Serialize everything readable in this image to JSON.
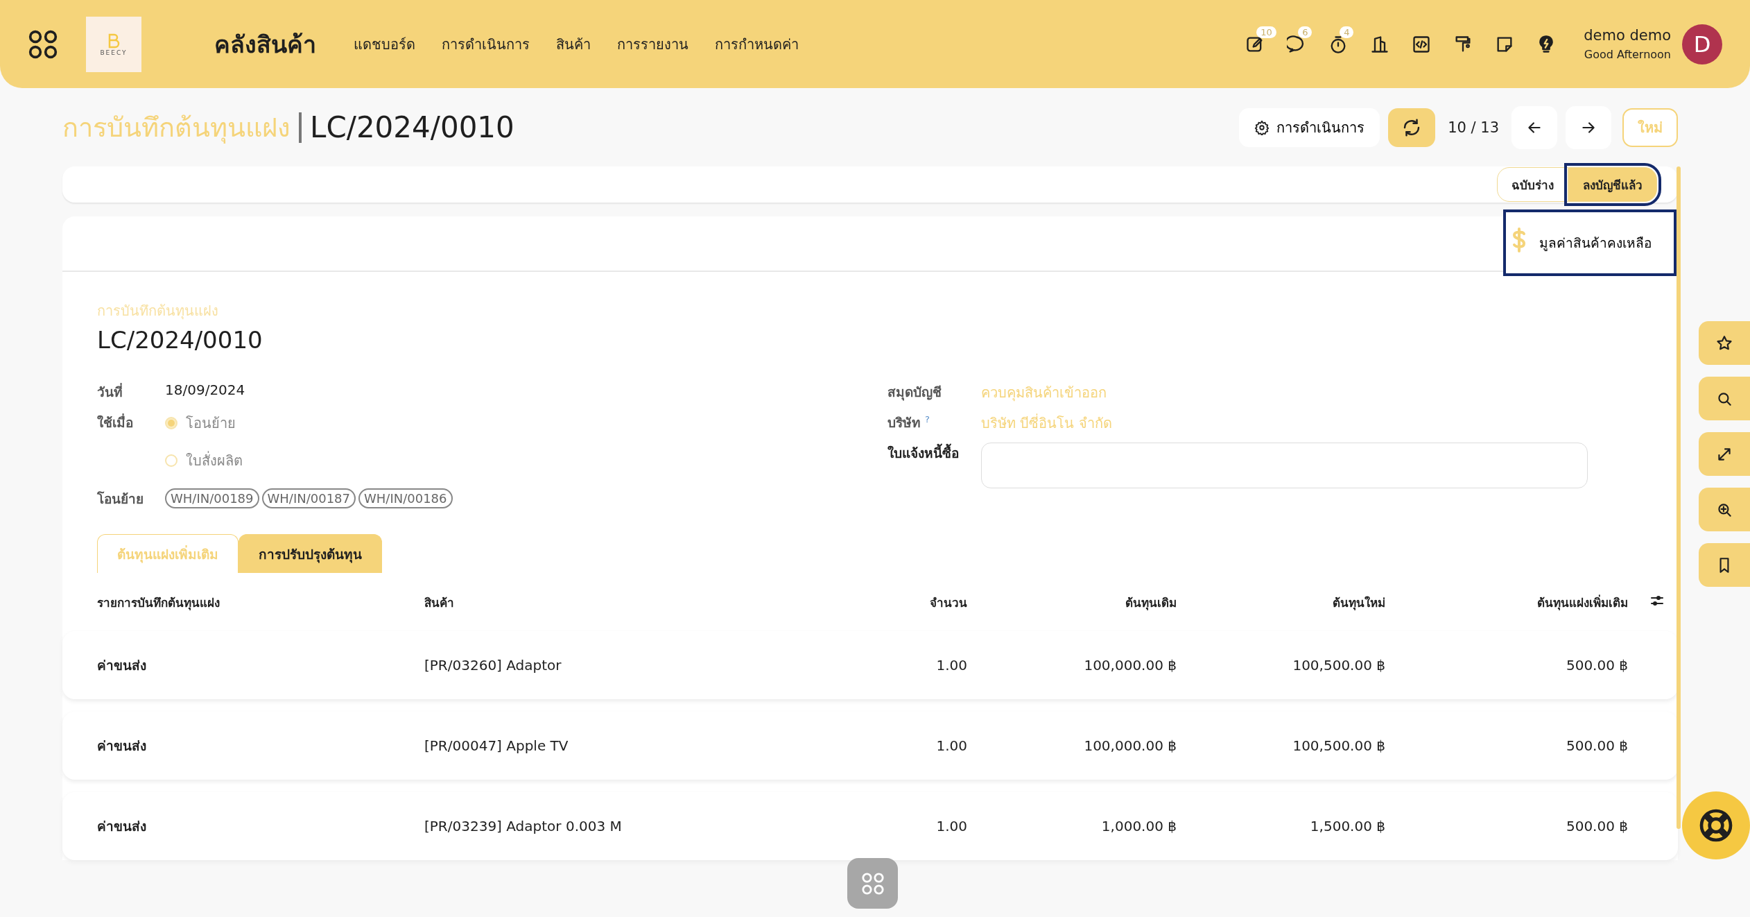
{
  "header": {
    "logo_text": "BEECY",
    "app_title": "คลังสินค้า"
  },
  "nav": [
    "แดชบอร์ด",
    "การดำเนินการ",
    "สินค้า",
    "การรายงาน",
    "การกำหนดค่า"
  ],
  "header_icons": [
    {
      "kind": "edit",
      "badge": "10"
    },
    {
      "kind": "chat",
      "badge": "6"
    },
    {
      "kind": "timer",
      "badge": "4"
    },
    {
      "kind": "building"
    },
    {
      "kind": "code"
    },
    {
      "kind": "paint"
    },
    {
      "kind": "note"
    },
    {
      "kind": "bulb"
    }
  ],
  "user": {
    "name": "demo demo",
    "greeting": "Good Afternoon",
    "initial": "D"
  },
  "breadcrumb": {
    "parent": "การบันทึกต้นทุนแฝง",
    "current": "LC/2024/0010"
  },
  "actions": {
    "menu": "การดำเนินการ",
    "pager": "10 / 13",
    "new": "ใหม่"
  },
  "statuses": [
    {
      "label": "ฉบับร่าง",
      "selected": false
    },
    {
      "label": "ลงบัญชีแล้ว",
      "selected": true
    }
  ],
  "smart_button": {
    "label": "มูลค่าสินค้าคงเหลือ"
  },
  "form": {
    "caption": "การบันทึกต้นทุนแฝง",
    "name": "LC/2024/0010",
    "date": {
      "label": "วันที่",
      "value": "18/09/2024"
    },
    "apply_on": {
      "label": "ใช้เมื่อ",
      "options": [
        {
          "label": "โอนย้าย",
          "selected": true
        },
        {
          "label": "ใบสั่งผลิต",
          "selected": false
        }
      ]
    },
    "transfers": {
      "label": "โอนย้าย",
      "tags": [
        "WH/IN/00189",
        "WH/IN/00187",
        "WH/IN/00186"
      ]
    },
    "journal": {
      "label": "สมุดบัญชี",
      "value": "ควบคุมสินค้าเข้าออก"
    },
    "company": {
      "label": "บริษัท",
      "help": "?",
      "value": "บริษัท บีซี่อินโน จำกัด"
    },
    "bills": {
      "label": "ใบแจ้งหนี้ซื้อ"
    }
  },
  "tabs": [
    {
      "label": "ต้นทุนแฝงเพิ่มเติม",
      "selected": false
    },
    {
      "label": "การปรับปรุงต้นทุน",
      "selected": true
    }
  ],
  "table": {
    "columns": [
      "รายการบันทึกต้นทุนแฝง",
      "สินค้า",
      "จำนวน",
      "ต้นทุนเดิม",
      "ต้นทุนใหม่",
      "ต้นทุนแฝงเพิ่มเติม"
    ],
    "rows": [
      [
        "ค่าขนส่ง",
        "[PR/03260] Adaptor",
        "1.00",
        "100,000.00 ฿",
        "100,500.00 ฿",
        "500.00 ฿"
      ],
      [
        "ค่าขนส่ง",
        "[PR/00047] Apple TV",
        "1.00",
        "100,000.00 ฿",
        "100,500.00 ฿",
        "500.00 ฿"
      ],
      [
        "ค่าขนส่ง",
        "[PR/03239] Adaptor 0.003 M",
        "1.00",
        "1,000.00 ฿",
        "1,500.00 ฿",
        "500.00 ฿"
      ]
    ]
  }
}
